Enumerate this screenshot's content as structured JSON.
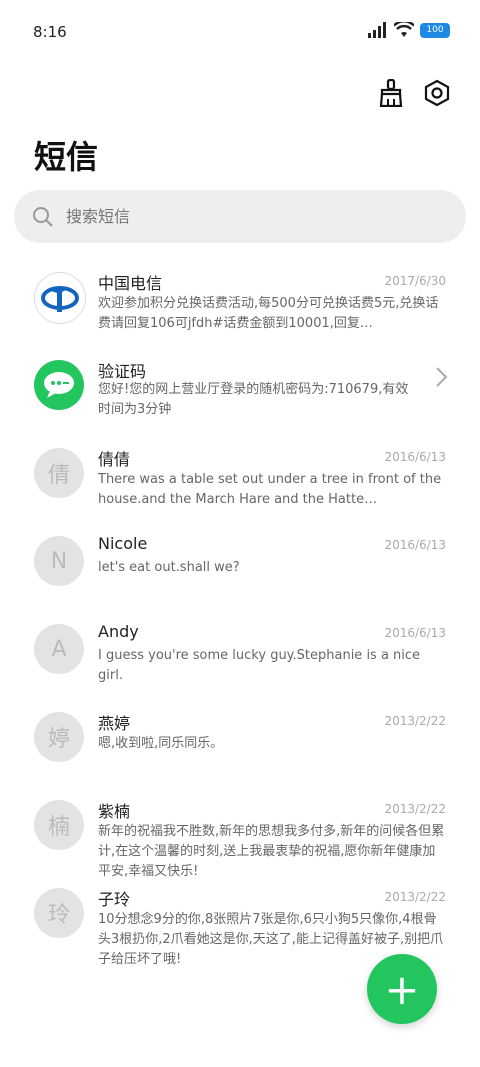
{
  "status_bar": {
    "time": "8:16",
    "battery": "100"
  },
  "header": {
    "title": "短信",
    "clean_icon": "broom-icon",
    "settings_icon": "gear-icon"
  },
  "search": {
    "placeholder": "搜索短信",
    "icon": "search-icon"
  },
  "messages": [
    {
      "name": "中国电信",
      "date": "2017/6/30",
      "preview": "欢迎参加积分兑换话费活动,每500分可兑换话费5元,兑换话费请回复106可jfdh#话费金额到10001,回复…",
      "avatar": "telecom-logo"
    },
    {
      "name": "验证码",
      "date": "",
      "preview": "您好!您的网上营业厅登录的随机密码为:710679,有效时间为3分钟",
      "avatar": "message-logo"
    },
    {
      "name": "倩倩",
      "date": "2016/6/13",
      "preview": "There was a table set out under a tree in front of the house.and the March Hare and the Hatte…",
      "avatar": "倩"
    },
    {
      "name": "Nicole",
      "date": "2016/6/13",
      "preview": "let's eat out.shall we?",
      "avatar": "N"
    },
    {
      "name": "Andy",
      "date": "2016/6/13",
      "preview": "I guess you're some lucky guy.Stephanie is a nice girl.",
      "avatar": "A"
    },
    {
      "name": "燕婷",
      "date": "2013/2/22",
      "preview": "嗯,收到啦,同乐同乐。",
      "avatar": "婷"
    },
    {
      "name": "紫楠",
      "date": "2013/2/22",
      "preview": "新年的祝福我不胜数,新年的思想我多付多,新年的问候各但累计,在这个温馨的时刻,送上我最衷挚的祝福,愿你新年健康加平安,幸福又快乐!",
      "avatar": "楠"
    },
    {
      "name": "子玲",
      "date": "2013/2/22",
      "preview": "10分想念9分的你,8张照片7张是你,6只小狗5只像你,4根骨头3根扔你,2爪看她这是你,天这了,能上记得盖好被子,别把爪子给压坏了哦!",
      "avatar": "玲"
    }
  ],
  "fab": {
    "label": "+"
  }
}
